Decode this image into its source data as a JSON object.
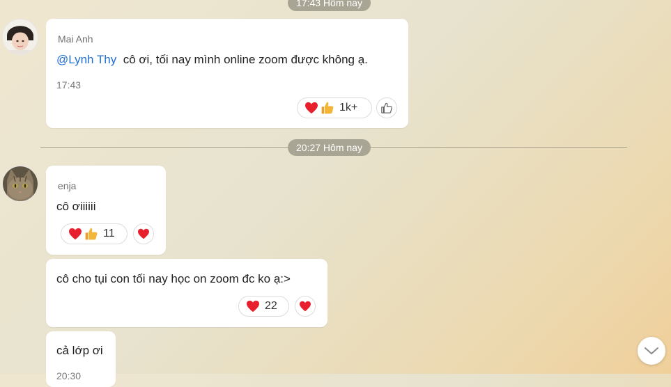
{
  "chat": {
    "time_separators": [
      {
        "label": "17:43 Hôm nay"
      },
      {
        "label": "20:27 Hôm nay"
      }
    ],
    "messages": [
      {
        "sender": "Mai Anh",
        "mention": "@Lynh Thy",
        "text": "cô ơi, tối nay mình online zoom được không ạ.",
        "time": "17:43",
        "reaction_count": "1k+",
        "reaction_icons": [
          "heart-icon",
          "thumbs-up-icon"
        ]
      },
      {
        "sender": "enja",
        "text": "cô ơiiiiii",
        "reaction_count": "11",
        "reaction_icons": [
          "heart-icon",
          "thumbs-up-icon"
        ]
      },
      {
        "text": "cô cho tụi con tối nay học on zoom đc ko ạ:>",
        "reaction_count": "22",
        "reaction_icons": [
          "heart-icon"
        ]
      },
      {
        "text": "cả lớp ơi",
        "time": "20:30"
      }
    ]
  },
  "colors": {
    "mention": "#1f6fd1",
    "heart": "#e8202e",
    "thumb": "#f4b63a",
    "time_pill_bg": "#a9a594"
  }
}
